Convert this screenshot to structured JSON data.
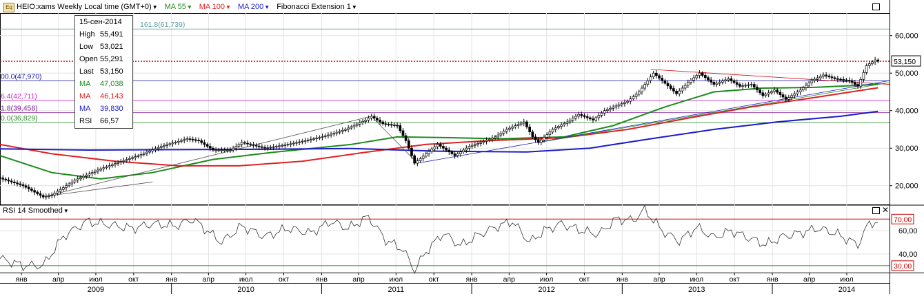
{
  "header": {
    "symbol_title": "HEIO:xams Weekly Local time (GMT+0)",
    "ma55_label": "MA 55",
    "ma100_label": "MA 100",
    "ma200_label": "MA 200",
    "fib_label": "Fibonacci Extension 1",
    "icon_text": "Eq"
  },
  "colors": {
    "ma55": "#1a8a1a",
    "ma100": "#e02020",
    "ma200": "#1a1acc",
    "current_price_line": "#cc0000",
    "rsi_upper": "#cc0000",
    "rsi_lower": "#1a8a1a"
  },
  "infobox": {
    "date": "15-сен-2014",
    "high_label": "High",
    "high": "55,491",
    "low_label": "Low",
    "low": "53,021",
    "open_label": "Open",
    "open": "55,291",
    "last_label": "Last",
    "last": "53,150",
    "ma1_label": "MA",
    "ma1": "47,038",
    "ma2_label": "MA",
    "ma2": "46,143",
    "ma3_label": "MA",
    "ma3": "39,830",
    "rsi_label": "RSI",
    "rsi": "66,57"
  },
  "fib_levels": [
    {
      "text": "161.8(61,739)",
      "price": 61.739,
      "color": "#5f9ea0"
    },
    {
      "text": "00.0(47,970)",
      "price": 47.97,
      "color": "#1a1aaa"
    },
    {
      "text": "6.4(42,711)",
      "price": 42.711,
      "color": "#cc22cc"
    },
    {
      "text": "1.8(39,458)",
      "price": 39.458,
      "color": "#7a1a9a"
    },
    {
      "text": "0.0(36,829)",
      "price": 36.829,
      "color": "#2a8a2a"
    }
  ],
  "current_price_label": "53,150",
  "rsi_panel": {
    "title": "RSI 14 Smoothed",
    "upper_label": "70,00",
    "lower_label": "30,00"
  },
  "chart_data": {
    "type": "line",
    "title": "HEIO:xams Weekly",
    "price_axis": {
      "ylim": [
        15,
        66
      ],
      "ticks": [
        "60,000",
        "50,000",
        "40,000",
        "30,000",
        "20,000"
      ],
      "tick_values": [
        60,
        50,
        40,
        30,
        20
      ]
    },
    "rsi_axis": {
      "ylim": [
        24,
        82
      ],
      "ticks": [
        "60,00",
        "40,00"
      ],
      "tick_values": [
        60,
        40
      ]
    },
    "time_axis": {
      "range": [
        "2008-11-10",
        "2014-10-13"
      ],
      "month_ticks": [
        {
          "label": "янв",
          "date": "2009-01-01"
        },
        {
          "label": "апр",
          "date": "2009-04-01"
        },
        {
          "label": "июл",
          "date": "2009-07-01"
        },
        {
          "label": "окт",
          "date": "2009-10-01"
        },
        {
          "label": "янв",
          "date": "2010-01-01"
        },
        {
          "label": "апр",
          "date": "2010-04-01"
        },
        {
          "label": "июл",
          "date": "2010-07-01"
        },
        {
          "label": "окт",
          "date": "2010-10-01"
        },
        {
          "label": "янв",
          "date": "2011-01-01"
        },
        {
          "label": "апр",
          "date": "2011-04-01"
        },
        {
          "label": "июл",
          "date": "2011-07-01"
        },
        {
          "label": "окт",
          "date": "2011-10-01"
        },
        {
          "label": "янв",
          "date": "2012-01-01"
        },
        {
          "label": "апр",
          "date": "2012-04-01"
        },
        {
          "label": "июл",
          "date": "2012-07-01"
        },
        {
          "label": "окт",
          "date": "2012-10-01"
        },
        {
          "label": "янв",
          "date": "2013-01-01"
        },
        {
          "label": "апр",
          "date": "2013-04-01"
        },
        {
          "label": "июл",
          "date": "2013-07-01"
        },
        {
          "label": "окт",
          "date": "2013-10-01"
        },
        {
          "label": "янв",
          "date": "2014-01-01"
        },
        {
          "label": "апр",
          "date": "2014-04-01"
        },
        {
          "label": "июл",
          "date": "2014-07-01"
        }
      ],
      "year_labels": [
        {
          "label": "2009",
          "date": "2009-07-01"
        },
        {
          "label": "2010",
          "date": "2010-07-01"
        },
        {
          "label": "2011",
          "date": "2011-07-01"
        },
        {
          "label": "2012",
          "date": "2012-07-01"
        },
        {
          "label": "2013",
          "date": "2013-07-01"
        },
        {
          "label": "2014",
          "date": "2014-07-01"
        }
      ],
      "year_separators": [
        "2010-01-01",
        "2011-01-01",
        "2012-01-01",
        "2013-01-01",
        "2014-01-01"
      ]
    },
    "price_anchors": [
      [
        "2008-11-10",
        22.0
      ],
      [
        "2009-01-05",
        20.0
      ],
      [
        "2009-02-23",
        17.0
      ],
      [
        "2009-03-16",
        17.5
      ],
      [
        "2009-05-11",
        21.5
      ],
      [
        "2009-07-13",
        24.5
      ],
      [
        "2009-09-14",
        27.0
      ],
      [
        "2009-10-12",
        28.0
      ],
      [
        "2009-12-07",
        30.5
      ],
      [
        "2010-02-08",
        32.5
      ],
      [
        "2010-03-08",
        32.0
      ],
      [
        "2010-04-12",
        29.5
      ],
      [
        "2010-05-24",
        29.5
      ],
      [
        "2010-06-21",
        31.5
      ],
      [
        "2010-08-16",
        30.0
      ],
      [
        "2010-10-11",
        31.0
      ],
      [
        "2010-12-13",
        32.5
      ],
      [
        "2011-01-17",
        33.5
      ],
      [
        "2011-02-28",
        35.0
      ],
      [
        "2011-04-18",
        37.5
      ],
      [
        "2011-05-02",
        38.5
      ],
      [
        "2011-05-30",
        36.5
      ],
      [
        "2011-07-04",
        36.0
      ],
      [
        "2011-07-25",
        32.0
      ],
      [
        "2011-08-15",
        26.0
      ],
      [
        "2011-09-12",
        28.5
      ],
      [
        "2011-10-10",
        31.0
      ],
      [
        "2011-11-21",
        28.0
      ],
      [
        "2011-12-26",
        30.5
      ],
      [
        "2012-01-23",
        31.5
      ],
      [
        "2012-02-27",
        33.0
      ],
      [
        "2012-03-26",
        35.0
      ],
      [
        "2012-05-07",
        37.0
      ],
      [
        "2012-05-28",
        33.0
      ],
      [
        "2012-06-11",
        31.5
      ],
      [
        "2012-07-16",
        35.0
      ],
      [
        "2012-08-20",
        37.0
      ],
      [
        "2012-09-17",
        39.0
      ],
      [
        "2012-10-22",
        37.5
      ],
      [
        "2012-11-19",
        40.0
      ],
      [
        "2013-01-14",
        42.5
      ],
      [
        "2013-02-11",
        45.0
      ],
      [
        "2013-03-18",
        50.0
      ],
      [
        "2013-04-08",
        48.0
      ],
      [
        "2013-05-13",
        44.5
      ],
      [
        "2013-06-10",
        47.5
      ],
      [
        "2013-07-08",
        50.0
      ],
      [
        "2013-08-12",
        47.0
      ],
      [
        "2013-09-16",
        48.5
      ],
      [
        "2013-10-14",
        46.5
      ],
      [
        "2013-11-11",
        47.0
      ],
      [
        "2013-12-09",
        44.0
      ],
      [
        "2014-01-06",
        45.5
      ],
      [
        "2014-02-03",
        43.0
      ],
      [
        "2014-03-10",
        45.5
      ],
      [
        "2014-04-07",
        48.0
      ],
      [
        "2014-05-05",
        49.5
      ],
      [
        "2014-06-02",
        48.5
      ],
      [
        "2014-07-07",
        48.0
      ],
      [
        "2014-07-28",
        46.5
      ],
      [
        "2014-08-18",
        52.0
      ],
      [
        "2014-09-08",
        53.5
      ],
      [
        "2014-09-15",
        53.15
      ]
    ],
    "series": [
      {
        "name": "MA 55",
        "points": [
          [
            "2008-11-10",
            28.0
          ],
          [
            "2009-03-16",
            23.5
          ],
          [
            "2009-07-13",
            21.8
          ],
          [
            "2009-11-16",
            23.5
          ],
          [
            "2010-04-12",
            27.0
          ],
          [
            "2010-09-13",
            29.0
          ],
          [
            "2011-03-14",
            31.0
          ],
          [
            "2011-07-04",
            33.0
          ],
          [
            "2011-11-07",
            32.8
          ],
          [
            "2012-03-12",
            32.5
          ],
          [
            "2012-08-13",
            33.0
          ],
          [
            "2012-12-10",
            36.0
          ],
          [
            "2013-04-15",
            41.0
          ],
          [
            "2013-08-12",
            45.0
          ],
          [
            "2013-12-09",
            46.0
          ],
          [
            "2014-04-14",
            46.2
          ],
          [
            "2014-09-15",
            47.0
          ]
        ]
      },
      {
        "name": "MA 100",
        "points": [
          [
            "2008-11-10",
            31.0
          ],
          [
            "2009-03-16",
            28.5
          ],
          [
            "2009-08-17",
            26.5
          ],
          [
            "2010-01-18",
            25.3
          ],
          [
            "2010-06-14",
            25.3
          ],
          [
            "2010-11-15",
            26.5
          ],
          [
            "2011-04-11",
            28.8
          ],
          [
            "2011-09-12",
            31.0
          ],
          [
            "2012-02-13",
            32.0
          ],
          [
            "2012-08-13",
            32.8
          ],
          [
            "2013-01-14",
            35.0
          ],
          [
            "2013-06-10",
            38.0
          ],
          [
            "2013-11-11",
            41.0
          ],
          [
            "2014-04-14",
            43.5
          ],
          [
            "2014-09-15",
            46.1
          ]
        ]
      },
      {
        "name": "MA 200",
        "points": [
          [
            "2008-11-10",
            29.8
          ],
          [
            "2009-06-15",
            29.5
          ],
          [
            "2010-01-18",
            29.6
          ],
          [
            "2010-08-16",
            29.7
          ],
          [
            "2011-03-14",
            29.9
          ],
          [
            "2011-10-10",
            29.2
          ],
          [
            "2012-05-14",
            29.0
          ],
          [
            "2012-10-15",
            30.0
          ],
          [
            "2013-03-11",
            32.5
          ],
          [
            "2013-08-12",
            35.0
          ],
          [
            "2014-01-13",
            37.0
          ],
          [
            "2014-06-16",
            38.5
          ],
          [
            "2014-09-15",
            39.8
          ]
        ]
      }
    ],
    "current_price": 53.15,
    "trendlines": [
      {
        "color": "#555555",
        "points": [
          [
            "2009-03-02",
            17.2
          ],
          [
            "2011-05-02",
            38.5
          ]
        ]
      },
      {
        "color": "#555555",
        "points": [
          [
            "2009-03-02",
            17.2
          ],
          [
            "2009-11-16",
            21.0
          ]
        ]
      },
      {
        "color": "#555555",
        "points": [
          [
            "2011-05-02",
            38.5
          ],
          [
            "2011-08-22",
            26.0
          ]
        ]
      },
      {
        "color": "#1a1acc",
        "points": [
          [
            "2011-08-22",
            26.0
          ],
          [
            "2014-10-13",
            48.0
          ]
        ]
      },
      {
        "color": "#1a8a1a",
        "points": [
          [
            "2012-06-11",
            31.5
          ],
          [
            "2014-10-13",
            47.5
          ]
        ]
      },
      {
        "color": "#cc0000",
        "points": [
          [
            "2013-03-11",
            51.0
          ],
          [
            "2014-10-13",
            47.0
          ]
        ]
      }
    ],
    "rsi": {
      "name": "RSI 14 Smoothed",
      "levels": [
        70,
        30
      ],
      "points": [
        [
          "2008-11-10",
          36
        ],
        [
          "2009-01-05",
          30
        ],
        [
          "2009-02-23",
          30
        ],
        [
          "2009-04-13",
          55
        ],
        [
          "2009-06-08",
          68
        ],
        [
          "2009-08-03",
          65
        ],
        [
          "2009-09-28",
          62
        ],
        [
          "2009-11-16",
          66
        ],
        [
          "2010-01-11",
          64
        ],
        [
          "2010-02-22",
          70
        ],
        [
          "2010-03-29",
          60
        ],
        [
          "2010-05-03",
          50
        ],
        [
          "2010-06-21",
          64
        ],
        [
          "2010-08-16",
          55
        ],
        [
          "2010-10-11",
          62
        ],
        [
          "2010-12-06",
          58
        ],
        [
          "2011-01-24",
          68
        ],
        [
          "2011-03-07",
          62
        ],
        [
          "2011-04-25",
          72
        ],
        [
          "2011-06-06",
          52
        ],
        [
          "2011-07-18",
          44
        ],
        [
          "2011-08-15",
          26
        ],
        [
          "2011-09-12",
          42
        ],
        [
          "2011-10-24",
          58
        ],
        [
          "2011-12-05",
          47
        ],
        [
          "2012-01-16",
          56
        ],
        [
          "2012-02-27",
          63
        ],
        [
          "2012-04-09",
          68
        ],
        [
          "2012-05-21",
          50
        ],
        [
          "2012-06-25",
          60
        ],
        [
          "2012-08-06",
          66
        ],
        [
          "2012-09-24",
          60
        ],
        [
          "2012-11-05",
          57
        ],
        [
          "2012-12-17",
          70
        ],
        [
          "2013-01-28",
          69
        ],
        [
          "2013-02-25",
          78
        ],
        [
          "2013-04-08",
          60
        ],
        [
          "2013-05-20",
          51
        ],
        [
          "2013-07-01",
          63
        ],
        [
          "2013-08-12",
          54
        ],
        [
          "2013-09-23",
          60
        ],
        [
          "2013-11-04",
          54
        ],
        [
          "2013-12-16",
          48
        ],
        [
          "2014-01-27",
          55
        ],
        [
          "2014-03-10",
          58
        ],
        [
          "2014-04-21",
          62
        ],
        [
          "2014-06-02",
          58
        ],
        [
          "2014-07-28",
          48
        ],
        [
          "2014-08-25",
          67
        ],
        [
          "2014-09-15",
          67
        ]
      ]
    },
    "grid": true,
    "legend": "top-left"
  }
}
